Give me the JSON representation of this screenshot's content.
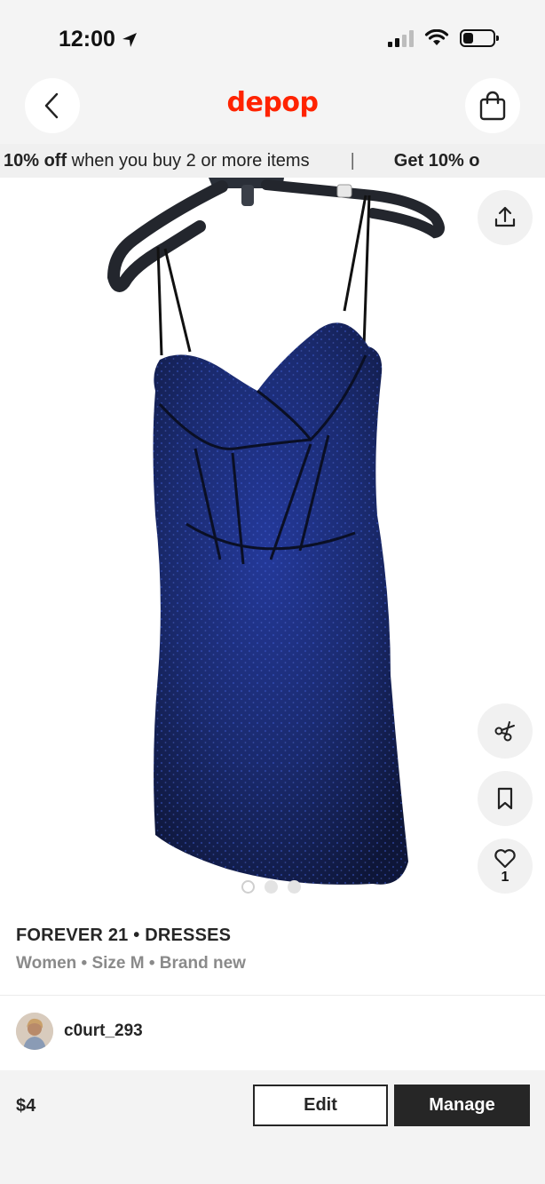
{
  "status_bar": {
    "time": "12:00",
    "battery_level": 0.35
  },
  "header": {
    "logo": "depop"
  },
  "promo": {
    "items": [
      {
        "bold": "10% off",
        "rest": " when you buy 2 or more items"
      },
      {
        "bold": "Get 10% o",
        "rest": ""
      }
    ],
    "separator": "|"
  },
  "gallery": {
    "like_count": "1",
    "image_count": 3,
    "active_image": 1
  },
  "product": {
    "brand_category": "FOREVER 21 • DRESSES",
    "attributes": "Women • Size M • Brand new"
  },
  "seller": {
    "username": "c0urt_293"
  },
  "bottom_bar": {
    "price": "$4",
    "edit_label": "Edit",
    "manage_label": "Manage"
  },
  "colors": {
    "brand": "#ff2300",
    "dress": "#1a2a6e",
    "dark": "#262626"
  }
}
